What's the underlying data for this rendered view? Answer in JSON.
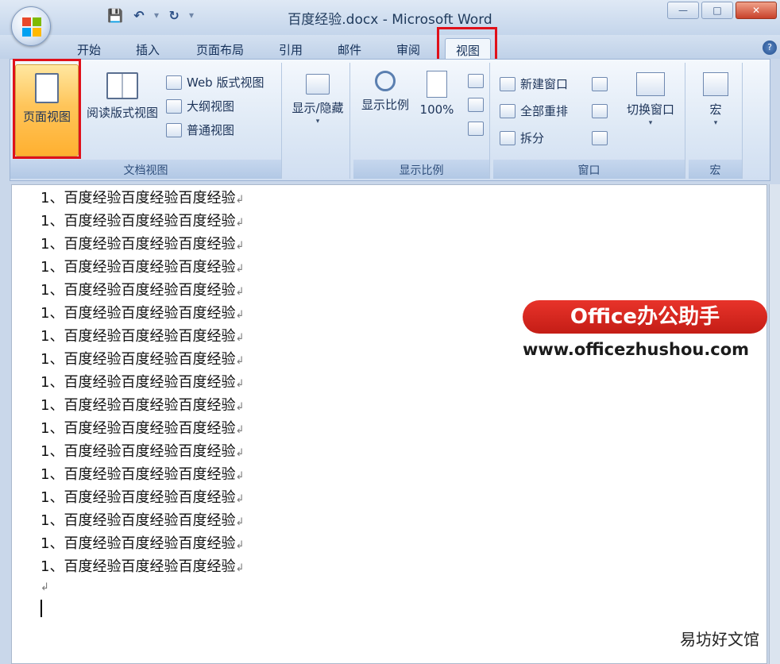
{
  "window": {
    "title": "百度经验.docx - Microsoft Word",
    "controls": [
      "—",
      "□",
      "✕"
    ]
  },
  "qat": {
    "save": "💾",
    "undo": "↶",
    "undo_drop": "▾",
    "redo": "↻",
    "customize": "▾"
  },
  "tabs": [
    "开始",
    "插入",
    "页面布局",
    "引用",
    "邮件",
    "审阅",
    "视图"
  ],
  "active_tab": "视图",
  "ribbon": {
    "doc_views": {
      "label": "文档视图",
      "page_view": "页面视图",
      "reading_view": "阅读版式视图",
      "web_view": "Web 版式视图",
      "outline_view": "大纲视图",
      "draft_view": "普通视图"
    },
    "show_hide": {
      "label": "显示/隐藏",
      "drop": "▾"
    },
    "zoom": {
      "label": "显示比例",
      "zoom_btn": "显示比例",
      "hundred": "100%"
    },
    "window": {
      "label": "窗口",
      "new_window": "新建窗口",
      "arrange_all": "全部重排",
      "split": "拆分",
      "switch_windows": "切换窗口",
      "drop": "▾"
    },
    "macros": {
      "label": "宏",
      "btn": "宏",
      "drop": "▾"
    }
  },
  "document": {
    "lines": [
      "1、百度经验百度经验百度经验",
      "1、百度经验百度经验百度经验",
      "1、百度经验百度经验百度经验",
      "1、百度经验百度经验百度经验",
      "1、百度经验百度经验百度经验",
      "1、百度经验百度经验百度经验",
      "1、百度经验百度经验百度经验",
      "1、百度经验百度经验百度经验",
      "1、百度经验百度经验百度经验",
      "1、百度经验百度经验百度经验",
      "1、百度经验百度经验百度经验",
      "1、百度经验百度经验百度经验",
      "1、百度经验百度经验百度经验",
      "1、百度经验百度经验百度经验",
      "1、百度经验百度经验百度经验",
      "1、百度经验百度经验百度经验",
      "1、百度经验百度经验百度经验"
    ],
    "para_mark": "↲"
  },
  "watermark": {
    "badge": "Office办公助手",
    "site": "www.officezhushou.com",
    "corner": "易坊好文馆"
  },
  "colors": {
    "highlight": "#e0101a",
    "active_button": "#ffc55a",
    "ribbon_bg": "#dde8f5"
  }
}
